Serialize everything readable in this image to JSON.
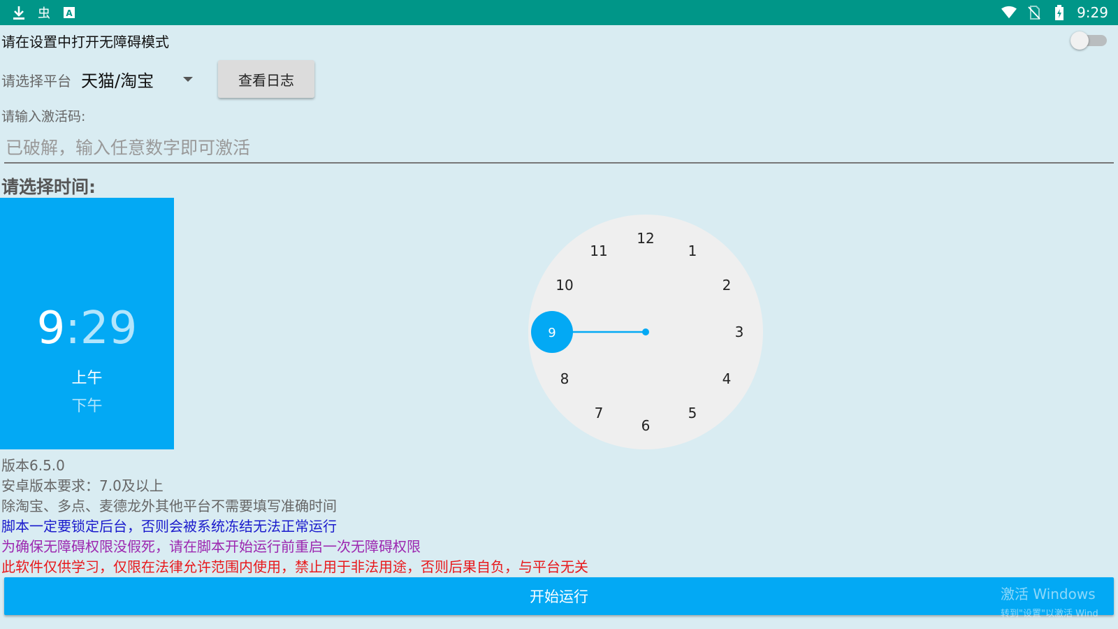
{
  "status_bar": {
    "time": "9:29",
    "left_icons": [
      "download-icon",
      "bug-icon",
      "a-text-icon"
    ],
    "right_icons": [
      "wifi-icon",
      "no-sim-icon",
      "battery-icon"
    ],
    "bug_glyph": "虫",
    "a_glyph": "A"
  },
  "accessibility": {
    "text": "请在设置中打开无障碍模式",
    "toggle_on": false
  },
  "platform": {
    "label": "请选择平台",
    "selected": "天猫/淘宝",
    "view_log_button": "查看日志"
  },
  "activation": {
    "label": "请输入激活码:",
    "placeholder": "已破解，输入任意数字即可激活",
    "value": ""
  },
  "time_picker": {
    "label": "请选择时间:",
    "hour": "9",
    "separator": ":",
    "minute": "29",
    "am": "上午",
    "pm": "下午",
    "selected_period": "上午",
    "clock_numbers": [
      "12",
      "1",
      "2",
      "3",
      "4",
      "5",
      "6",
      "7",
      "8",
      "9",
      "10",
      "11"
    ],
    "selected_hour": 9,
    "accent_color": "#03a9f4",
    "clock_face_color": "#efefef"
  },
  "info": {
    "version": "版本6.5.0",
    "android_req": "安卓版本要求：7.0及以上",
    "note1": "除淘宝、多点、麦德龙外其他平台不需要填写准确时间",
    "note2": "脚本一定要锁定后台，否则会被系统冻结无法正常运行",
    "note3": "为确保无障碍权限没假死，请在脚本开始运行前重启一次无障碍权限",
    "note4": "此软件仅供学习，仅限在法律允许范围内使用，禁止用于非法用途，否则后果自负，与平台无关"
  },
  "start_button": "开始运行",
  "watermark": {
    "line1": "激活 Windows",
    "line2": "转到\"设置\"以激活 Wind"
  }
}
